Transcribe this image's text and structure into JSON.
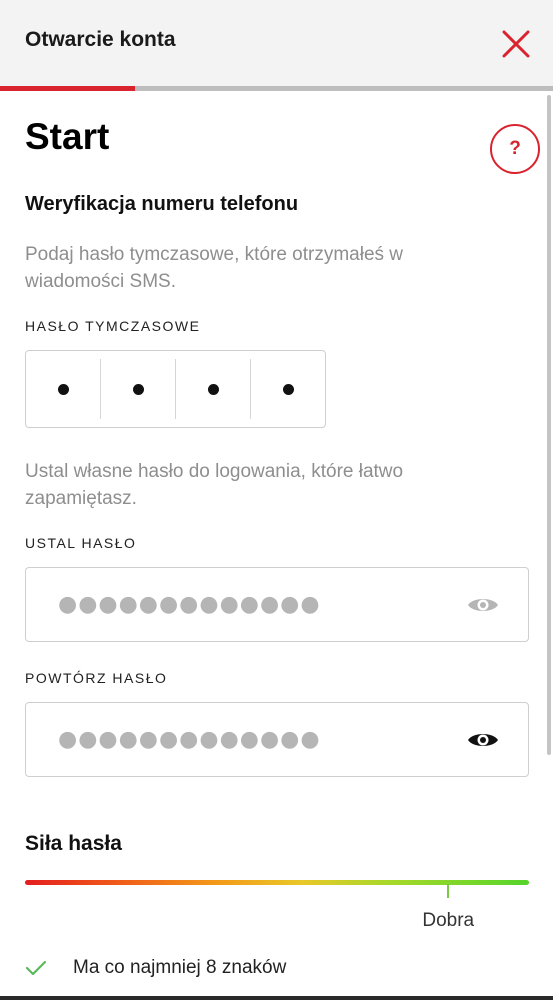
{
  "header": {
    "title": "Otwarcie konta",
    "close_icon": "close-icon"
  },
  "progress": {
    "fraction": 0.245,
    "color": "#d9232e"
  },
  "page": {
    "title": "Start",
    "help_label": "?"
  },
  "phone_verification": {
    "title": "Weryfikacja numeru telefonu",
    "description": "Podaj hasło tymczasowe, które otrzymałeś w wiadomości SMS.",
    "temp_password_label": "HASŁO TYMCZASOWE",
    "otp_filled": [
      true,
      true,
      true,
      true
    ]
  },
  "set_password": {
    "description": "Ustal własne hasło do logowania, które łatwo zapamiętasz.",
    "new_label": "USTAL HASŁO",
    "new_value_mask": "●●●●●●●●●●●●●",
    "new_eye_icon": "eye-icon",
    "repeat_label": "POWTÓRZ HASŁO",
    "repeat_value_mask": "●●●●●●●●●●●●●",
    "repeat_eye_icon": "eye-icon"
  },
  "strength": {
    "title": "Siła hasła",
    "level_label": "Dobra",
    "level_fraction": 0.84
  },
  "requirements": [
    {
      "text": "Ma co najmniej 8 znaków",
      "met": true,
      "icon": "check-icon"
    }
  ],
  "colors": {
    "accent": "#d9232e",
    "check": "#5cb85c",
    "muted_text": "#8e8e8e"
  }
}
